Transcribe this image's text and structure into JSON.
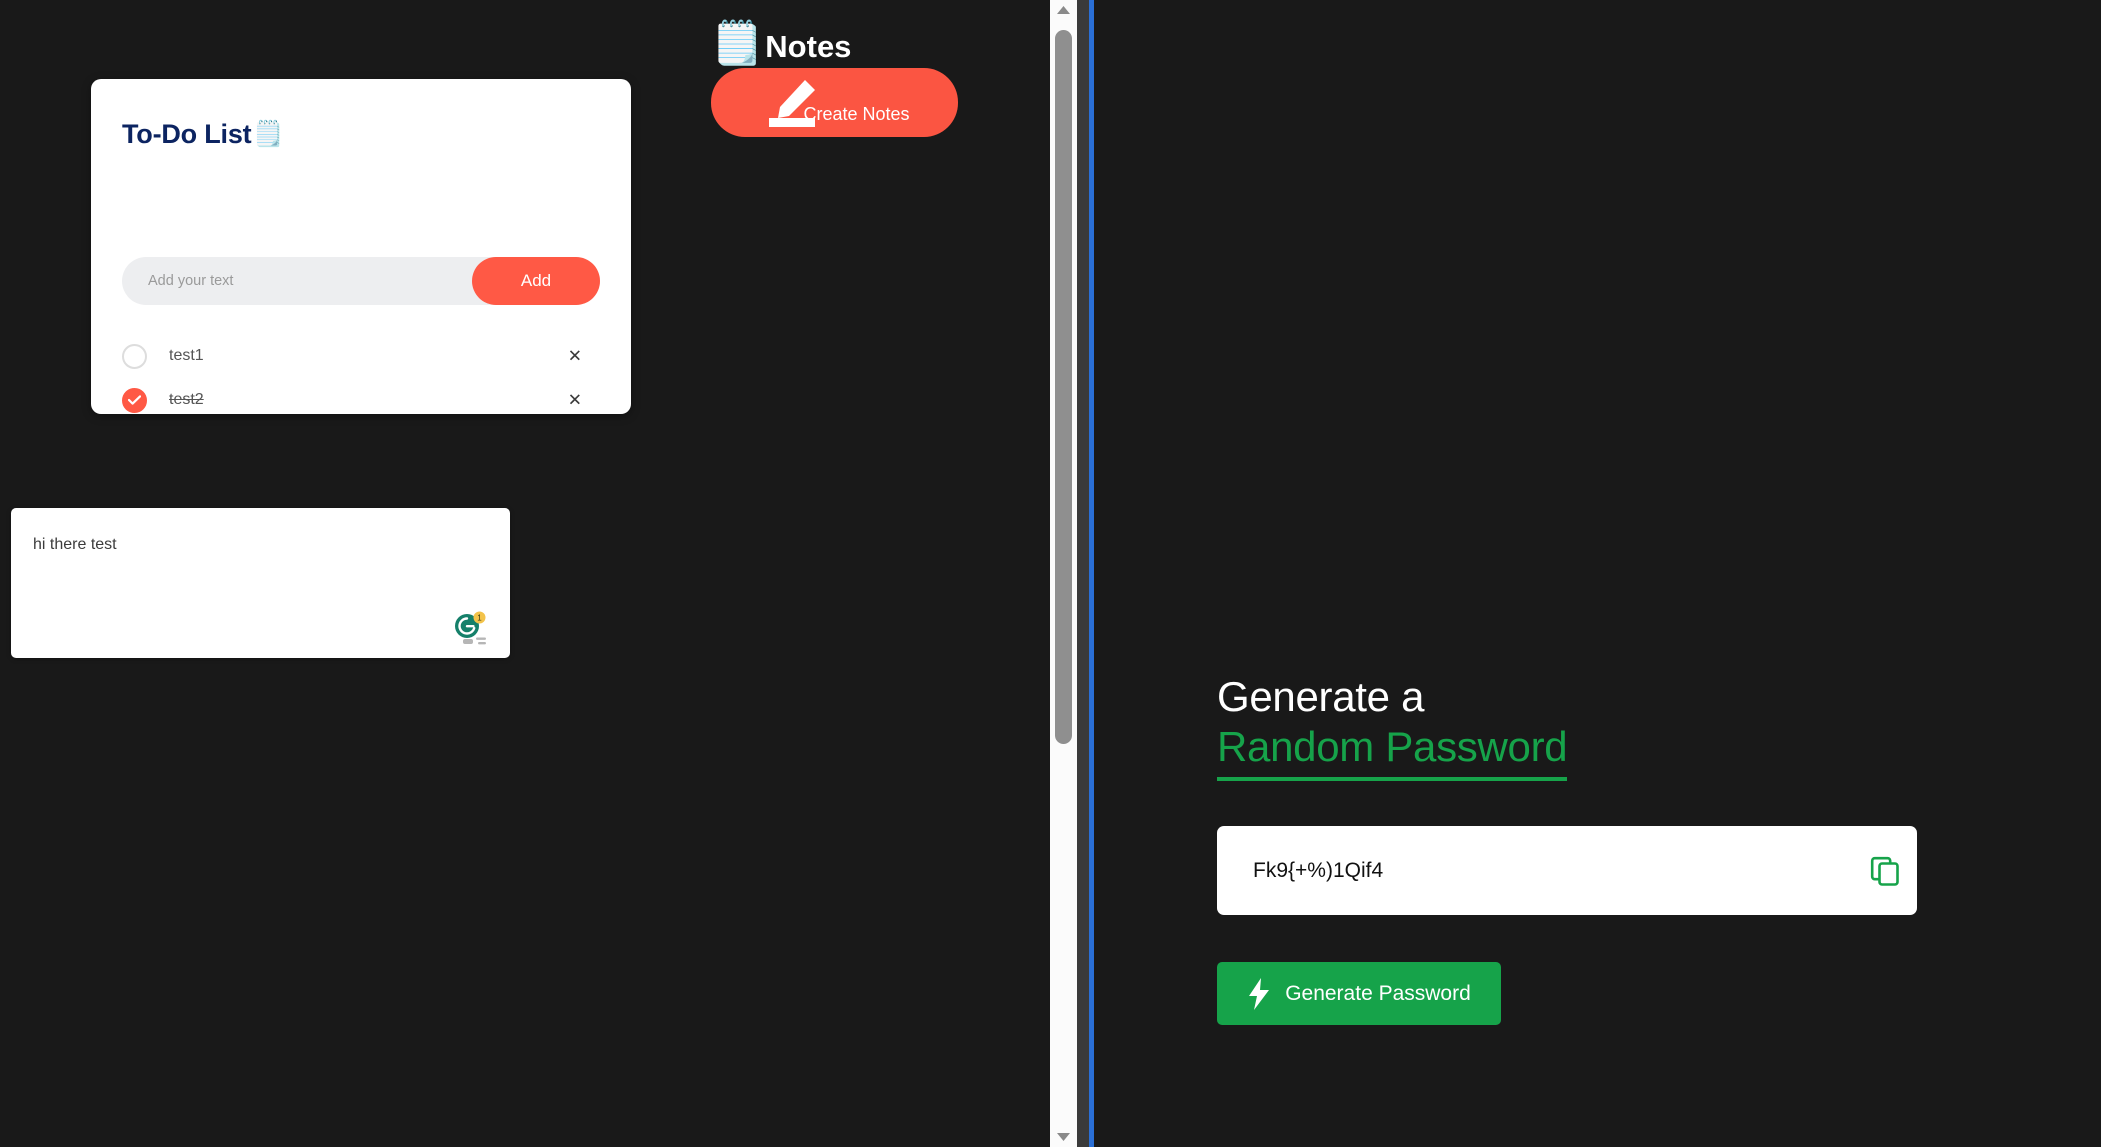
{
  "theme": {
    "page_background": "#191919",
    "accent_red": "#ff5945",
    "accent_green": "#16a34a",
    "divider_blue": "#2a6fd6",
    "card_white": "#ffffff",
    "todo_title_color": "#0c2461"
  },
  "todo": {
    "title": "To-Do List",
    "title_emoji": "🗒️",
    "input_placeholder": "Add your text",
    "input_value": "",
    "add_label": "Add",
    "delete_glyph": "✕",
    "items": [
      {
        "label": "test1",
        "completed": false
      },
      {
        "label": "test2",
        "completed": true
      }
    ]
  },
  "notes": {
    "heading": "Notes",
    "heading_emoji": "🗒️",
    "create_label": "Create Notes",
    "pencil_icon": "pencil-icon"
  },
  "note_box": {
    "text": "hi there test",
    "assistant_icon": "grammarly-icon",
    "assistant_badge": "1"
  },
  "scrollbar": {
    "up_arrow": "▲",
    "down_arrow": "▼",
    "thumb_icon": "scrollbar-thumb"
  },
  "password": {
    "heading_line1": "Generate a",
    "heading_line2": "Random Password",
    "value": "Fk9{+%)1Qif4",
    "placeholder": "",
    "copy_icon": "copy-icon",
    "bolt_icon": "lightning-bolt-icon",
    "generate_label": "Generate Password"
  }
}
